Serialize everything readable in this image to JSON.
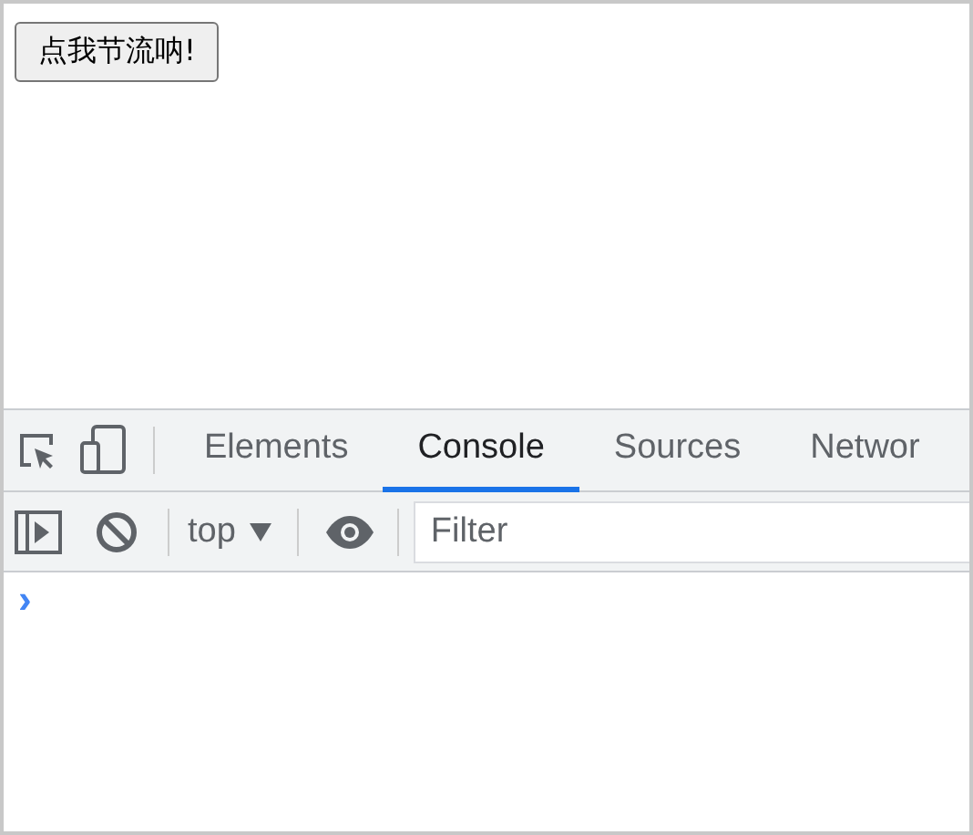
{
  "page": {
    "button": "点我节流呐!"
  },
  "devtools": {
    "tabs": [
      {
        "label": "Elements",
        "selected": false
      },
      {
        "label": "Console",
        "selected": true
      },
      {
        "label": "Sources",
        "selected": false
      },
      {
        "label": "Networ",
        "selected": false
      }
    ],
    "context": "top",
    "filter": {
      "placeholder": "Filter"
    },
    "prompt": "›"
  }
}
